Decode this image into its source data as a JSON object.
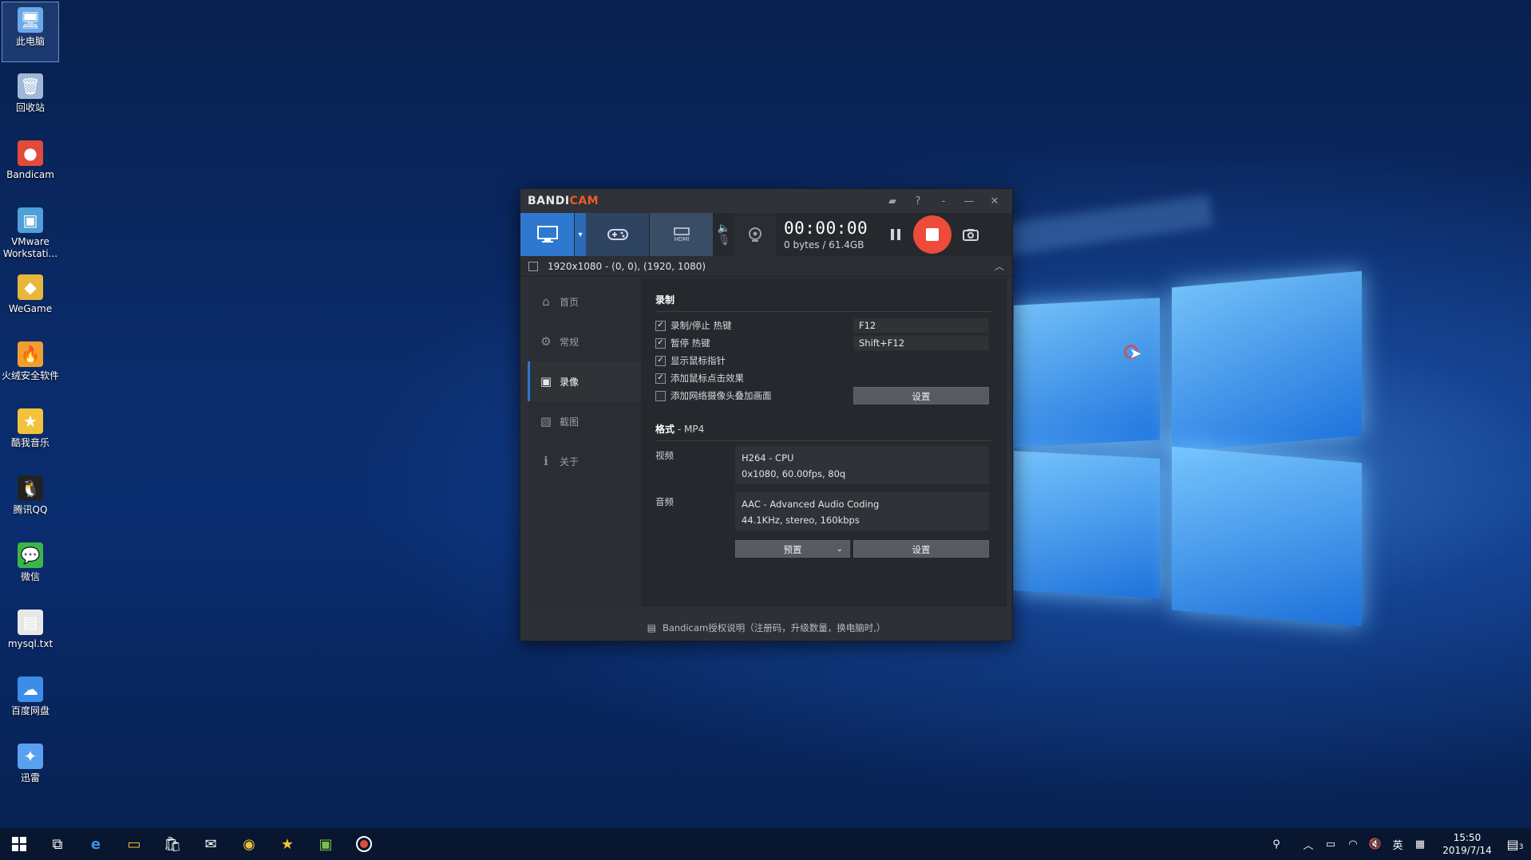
{
  "desktop": {
    "icons": [
      {
        "label": "此电脑",
        "icon": "computer-icon",
        "color": "#6aa8e8"
      },
      {
        "label": "回收站",
        "icon": "recycle-bin-icon",
        "color": "#9fb8d6"
      },
      {
        "label": "Bandicam",
        "icon": "bandicam-icon",
        "color": "#e24a3a"
      },
      {
        "label": "VMware Workstati...",
        "icon": "vmware-icon",
        "color": "#4f9fd8"
      },
      {
        "label": "WeGame",
        "icon": "wegame-icon",
        "color": "#e8b63a"
      },
      {
        "label": "火绒安全软件",
        "icon": "huorong-icon",
        "color": "#f0a030"
      },
      {
        "label": "酷我音乐",
        "icon": "kuwo-icon",
        "color": "#f2c23a"
      },
      {
        "label": "腾讯QQ",
        "icon": "qq-icon",
        "color": "#222222"
      },
      {
        "label": "微信",
        "icon": "wechat-icon",
        "color": "#3bb54a"
      },
      {
        "label": "mysql.txt",
        "icon": "text-file-icon",
        "color": "#e8e8e8"
      },
      {
        "label": "百度网盘",
        "icon": "baidu-netdisk-icon",
        "color": "#3a8ee8"
      },
      {
        "label": "迅雷",
        "icon": "xunlei-icon",
        "color": "#5aa0f0"
      }
    ]
  },
  "bandicam": {
    "brand_a": "BANDI",
    "brand_b": "CAM",
    "title_buttons": [
      "folder-icon",
      "help-icon",
      "minimize-to-tray-icon",
      "minimize-icon",
      "close-icon"
    ],
    "title_glyphs": {
      "folder": "▰",
      "help": "?",
      "tray": "-",
      "min": "—",
      "close": "✕"
    },
    "timer": "00:00:00",
    "bytes": "0 bytes / 61.4GB",
    "area_text": "1920x1080 - (0, 0), (1920, 1080)",
    "sidebar": [
      {
        "label": "首页",
        "icon": "home-icon",
        "glyph": "⌂"
      },
      {
        "label": "常规",
        "icon": "gear-icon",
        "glyph": "⚙"
      },
      {
        "label": "录像",
        "icon": "video-record-icon",
        "glyph": "▣"
      },
      {
        "label": "截图",
        "icon": "screenshot-icon",
        "glyph": "▧"
      },
      {
        "label": "关于",
        "icon": "info-icon",
        "glyph": "ℹ"
      }
    ],
    "record": {
      "title": "录制",
      "options": [
        {
          "label": "录制/停止 热键",
          "checked": true,
          "value": "F12"
        },
        {
          "label": "暂停 热键",
          "checked": true,
          "value": "Shift+F12"
        },
        {
          "label": "显示鼠标指针",
          "checked": true
        },
        {
          "label": "添加鼠标点击效果",
          "checked": true
        },
        {
          "label": "添加网络摄像头叠加画面",
          "checked": false,
          "button": "设置"
        }
      ]
    },
    "format": {
      "title": "格式",
      "container": " - MP4",
      "video_label": "视频",
      "video_line1": "H264 - CPU",
      "video_line2": "0x1080, 60.00fps, 80q",
      "audio_label": "音频",
      "audio_line1": "AAC - Advanced Audio Coding",
      "audio_line2": "44.1KHz, stereo, 160kbps",
      "preset_button": "预置",
      "settings_button": "设置"
    },
    "footer": "Bandicam授权说明（注册码，升级数量，换电脑时,）",
    "accent": "#2e78cf",
    "record_color": "#ee4b3a"
  },
  "taskbar": {
    "time": "15:50",
    "date": "2019/7/14",
    "ime": "英",
    "notification_count": "3"
  }
}
